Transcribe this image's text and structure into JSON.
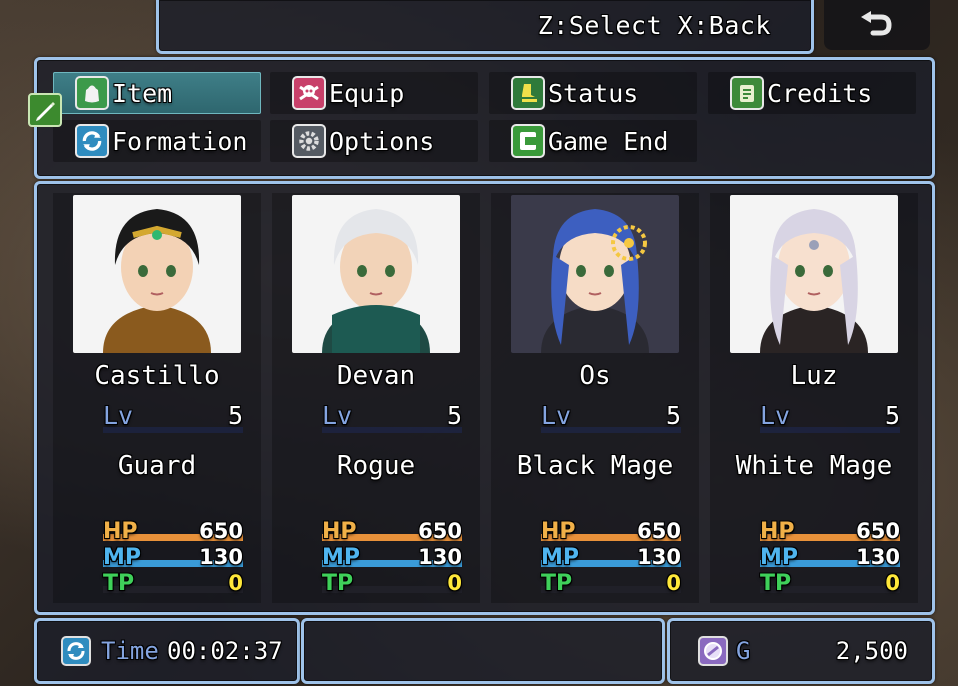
{
  "help": {
    "text": "Z:Select X:Back"
  },
  "back_button": {
    "icon": "return-arrow-icon"
  },
  "menu": {
    "commands": [
      {
        "label": "Item",
        "icon": "bag-icon",
        "icon_color": "#3c9a4a",
        "selected": true
      },
      {
        "label": "Equip",
        "icon": "skull-crossbones-icon",
        "icon_color": "#c8406a",
        "selected": false
      },
      {
        "label": "Status",
        "icon": "boot-icon",
        "icon_color": "#2f7a3a",
        "selected": false
      },
      {
        "label": "Credits",
        "icon": "scroll-icon",
        "icon_color": "#3d8a3a",
        "selected": false
      },
      {
        "label": "Formation",
        "icon": "refresh-icon",
        "icon_color": "#2f8cbf",
        "selected": false
      },
      {
        "label": "Options",
        "icon": "gear-icon",
        "icon_color": "#555b63",
        "selected": false
      },
      {
        "label": "Game End",
        "icon": "exit-door-icon",
        "icon_color": "#3a9a3a",
        "selected": false
      }
    ]
  },
  "party": [
    {
      "name": "Castillo",
      "lv_label": "Lv",
      "level": "5",
      "class": "Guard",
      "hp_label": "HP",
      "hp": "650",
      "mp_label": "MP",
      "mp": "130",
      "tp_label": "TP",
      "tp": "0",
      "hp_fill": 1.0,
      "mp_fill": 1.0,
      "tp_fill": 0.0,
      "hair": "#1a1a1a",
      "skin": "#f3d2b5",
      "outfit": "#8a5a1e"
    },
    {
      "name": "Devan",
      "lv_label": "Lv",
      "level": "5",
      "class": "Rogue",
      "hp_label": "HP",
      "hp": "650",
      "mp_label": "MP",
      "mp": "130",
      "tp_label": "TP",
      "tp": "0",
      "hp_fill": 1.0,
      "mp_fill": 1.0,
      "tp_fill": 0.0,
      "hair": "#e4e6ea",
      "skin": "#f2d3b8",
      "outfit": "#1f4a44"
    },
    {
      "name": "Os",
      "lv_label": "Lv",
      "level": "5",
      "class": "Black Mage",
      "hp_label": "HP",
      "hp": "650",
      "mp_label": "MP",
      "mp": "130",
      "tp_label": "TP",
      "tp": "0",
      "hp_fill": 1.0,
      "mp_fill": 1.0,
      "tp_fill": 0.0,
      "hair": "#3d5fc0",
      "skin": "#f6dcc6",
      "outfit": "#2a2a32"
    },
    {
      "name": "Luz",
      "lv_label": "Lv",
      "level": "5",
      "class": "White Mage",
      "hp_label": "HP",
      "hp": "650",
      "mp_label": "MP",
      "mp": "130",
      "tp_label": "TP",
      "tp": "0",
      "hp_fill": 1.0,
      "mp_fill": 1.0,
      "tp_fill": 0.0,
      "hair": "#d8d4e4",
      "skin": "#f7e0cf",
      "outfit": "#2a2424"
    }
  ],
  "colors": {
    "hp_gauge": "#e8913a",
    "mp_gauge": "#3a9bd8",
    "tp_gauge": "#2fbf4a",
    "hp_label": "#f0b048",
    "mp_label": "#4fb4ee",
    "tp_label": "#3fd05a",
    "level_label": "#84a4e0",
    "tp_value": "#ffe83a",
    "window_border": "#9fc3ea"
  },
  "playtime": {
    "label": "Time",
    "value": "00:02:37",
    "icon": "refresh-icon"
  },
  "gold": {
    "label": "G",
    "value": "2,500",
    "icon": "coin-icon"
  },
  "touch_icon": "pen-icon"
}
